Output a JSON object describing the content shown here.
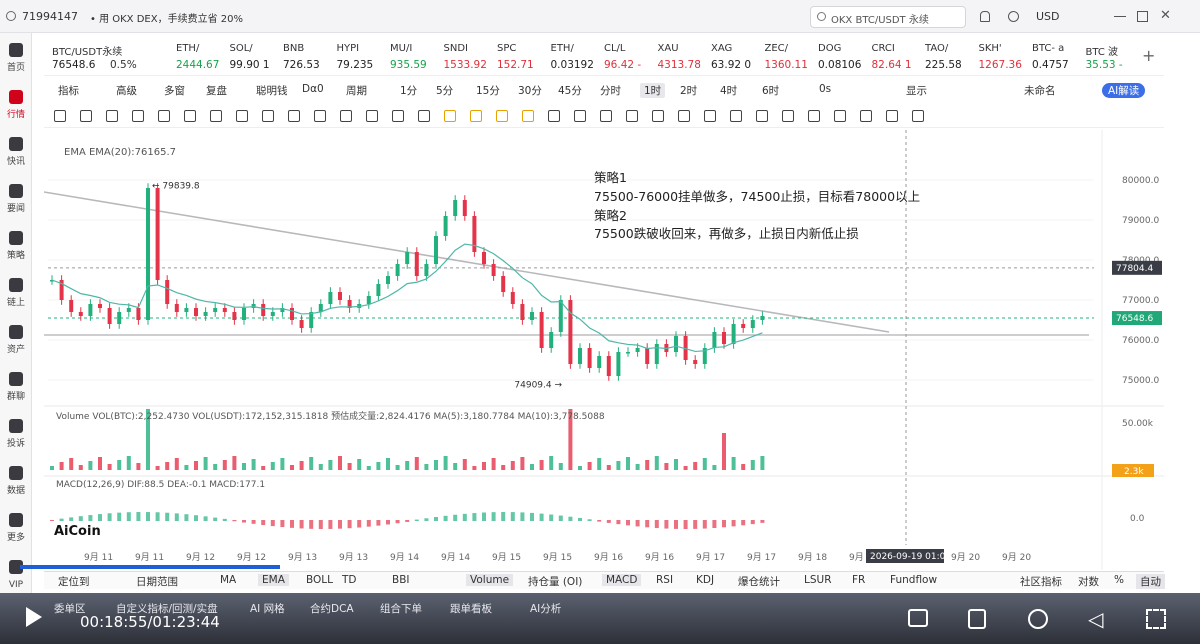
{
  "topbar": {
    "id_label": "71994147",
    "promo_text": "• 用 OKX DEX，手续费立省 20%",
    "search_text": "OKX BTC/USDT 永续",
    "currency": "USD"
  },
  "sidebar": [
    {
      "label": "首页"
    },
    {
      "label": "行情",
      "active": true
    },
    {
      "label": "快讯"
    },
    {
      "label": "要闻"
    },
    {
      "label": "策略"
    },
    {
      "label": "链上"
    },
    {
      "label": "资产"
    },
    {
      "label": "群聊"
    },
    {
      "label": "投诉"
    },
    {
      "label": "数据"
    },
    {
      "label": "更多"
    },
    {
      "label": "VIP"
    }
  ],
  "tickers": [
    {
      "name": "BTC/USDT永续",
      "price": "76548.6",
      "change": "0.5%",
      "color": "#222222"
    },
    {
      "name": "ETH/",
      "price": "2444.67",
      "color": "#16a34a"
    },
    {
      "name": "SOL/",
      "price": "99.90 1",
      "color": "#222222"
    },
    {
      "name": "BNB",
      "price": "726.53",
      "color": "#222222"
    },
    {
      "name": "HYPI",
      "price": "79.235",
      "color": "#222222"
    },
    {
      "name": "MU/I",
      "price": "935.59",
      "color": "#16a34a"
    },
    {
      "name": "SNDI",
      "price": "1533.92",
      "color": "#e0303a"
    },
    {
      "name": "SPC",
      "price": "152.71",
      "color": "#e0303a"
    },
    {
      "name": "ETH/",
      "price": "0.03192",
      "color": "#222222"
    },
    {
      "name": "CL/L",
      "price": "96.42 -",
      "color": "#e0303a"
    },
    {
      "name": "XAU",
      "price": "4313.78",
      "color": "#e0303a"
    },
    {
      "name": "XAG",
      "price": "63.92 0",
      "color": "#222222"
    },
    {
      "name": "ZEC/",
      "price": "1360.11",
      "color": "#e0303a"
    },
    {
      "name": "DOG",
      "price": "0.08106",
      "color": "#222222"
    },
    {
      "name": "CRCI",
      "price": "82.64 1",
      "color": "#e0303a"
    },
    {
      "name": "TAO/",
      "price": "225.58",
      "color": "#222222"
    },
    {
      "name": "SKH'",
      "price": "1267.36",
      "color": "#e0303a"
    },
    {
      "name": "BTC- a",
      "price": "0.4757",
      "color": "#222222"
    },
    {
      "name": "BTC 波",
      "price": "35.53 -",
      "color": "#16a34a"
    }
  ],
  "toolbar1": [
    "指标",
    "高级",
    "多窗",
    "复盘",
    "聪明钱",
    "Dα0",
    "周期",
    "1分",
    "5分",
    "15分",
    "30分",
    "45分",
    "分时",
    "1时",
    "2时",
    "4时",
    "6时",
    "0s",
    "显示",
    "未命名",
    "AI解读"
  ],
  "chart_data": {
    "type": "candlestick",
    "symbol": "BTC/USDT永续",
    "interval": "1时",
    "ema_label": "EMA  EMA(20):76165.7",
    "volume_label": "Volume  VOL(BTC):2,252.4730  VOL(USDT):172,152,315.1818  预估成交量:2,824.4176  MA(5):3,180.7784  MA(10):3,778.5088",
    "macd_label": "MACD(12,26,9)  DIF:88.5  DEA:-0.1  MACD:177.1",
    "price_ticks": [
      "80000.0",
      "79000.0",
      "78000.0",
      "77000.0",
      "76000.0",
      "75000.0"
    ],
    "volume_ticks": [
      "50.00k"
    ],
    "macd_ticks": [
      "0.0"
    ],
    "x_ticks": [
      "9月 11",
      "9月 11",
      "9月 12",
      "9月 12",
      "9月 13",
      "9月 13",
      "9月 14",
      "9月 14",
      "9月 15",
      "9月 15",
      "9月 16",
      "9月 16",
      "9月 17",
      "9月 17",
      "9月 18",
      "9月",
      "9月 19",
      "9月 20",
      "9月 20"
    ],
    "crosshair_time": "2026-09-19 01:00",
    "crosshair_price": "77804.4",
    "last_price": "76548.6",
    "last_volume": "2.3k",
    "high_label": "79839.8",
    "low_label": "74909.4",
    "ylim": [
      74500,
      80500
    ],
    "watermark": "AiCoin"
  },
  "notes": [
    "策略1",
    "75500-76000挂单做多，74500止损，目标看78000以上",
    "策略2",
    "75500跌破收回来，再做多，止损日内新低止损"
  ],
  "bottom_tabs": [
    "定位到",
    "日期范围",
    "MA",
    "EMA",
    "BOLL",
    "TD",
    "BBI",
    "Volume",
    "持仓量 (OI)",
    "MACD",
    "RSI",
    "KDJ",
    "爆仓统计",
    "LSUR",
    "FR",
    "Fundflow",
    "社区指标",
    "对数",
    "%",
    "自动"
  ],
  "video": {
    "time": "00:18:55/01:23:44",
    "tabs": [
      "委单区",
      "自定义指标/回测/实盘",
      "AI 网格",
      "合约DCA",
      "组合下单",
      "跟单看板",
      "AI分析"
    ]
  }
}
